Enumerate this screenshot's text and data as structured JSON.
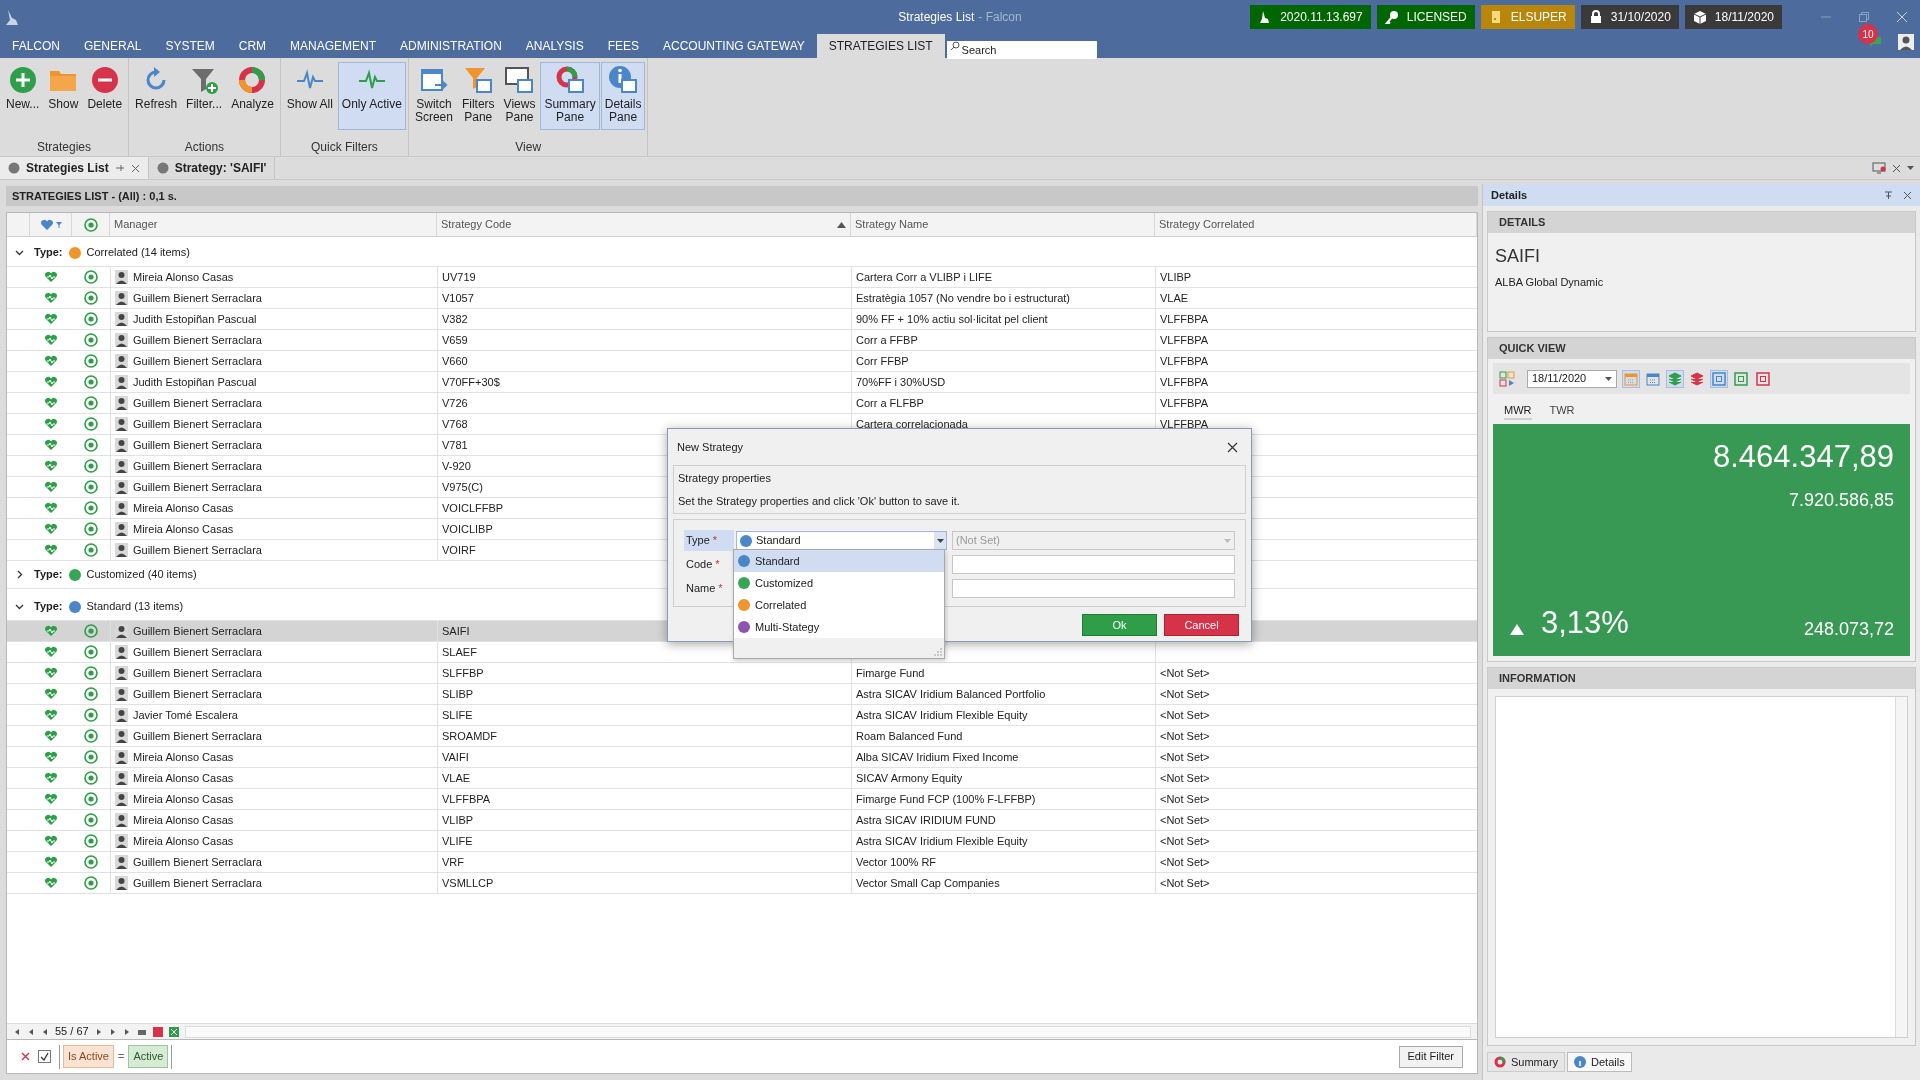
{
  "window": {
    "title": "Strategies List",
    "app_suffix": "- Falcon"
  },
  "status_badges": [
    {
      "label": "2020.11.13.697",
      "color": "#006600"
    },
    {
      "label": "LICENSED",
      "color": "#006600"
    },
    {
      "label": "ELSUPER",
      "color": "#b8860b"
    },
    {
      "label": "31/10/2020",
      "color": "#3a3a3a"
    },
    {
      "label": "18/11/2020",
      "color": "#3a3a3a"
    }
  ],
  "notification_count": "10",
  "menu": [
    {
      "label": "FALCON",
      "selected": false
    },
    {
      "label": "GENERAL",
      "selected": false
    },
    {
      "label": "SYSTEM",
      "selected": false
    },
    {
      "label": "CRM",
      "selected": false
    },
    {
      "label": "MANAGEMENT",
      "selected": false
    },
    {
      "label": "ADMINISTRATION",
      "selected": false
    },
    {
      "label": "ANALYSIS",
      "selected": false
    },
    {
      "label": "FEES",
      "selected": false
    },
    {
      "label": "ACCOUNTING GATEWAY",
      "selected": false
    },
    {
      "label": "STRATEGIES LIST",
      "selected": true
    }
  ],
  "search": {
    "placeholder": "Search"
  },
  "ribbon": [
    {
      "label": "Strategies",
      "buttons": [
        {
          "label": "New...",
          "selected": false
        },
        {
          "label": "Show",
          "selected": false
        },
        {
          "label": "Delete",
          "selected": false
        }
      ]
    },
    {
      "label": "Actions",
      "buttons": [
        {
          "label": "Refresh",
          "selected": false
        },
        {
          "label": "Filter...",
          "selected": false
        },
        {
          "label": "Analyze",
          "selected": false
        }
      ]
    },
    {
      "label": "Quick Filters",
      "buttons": [
        {
          "label": "Show All",
          "selected": false
        },
        {
          "label": "Only Active",
          "selected": true
        }
      ]
    },
    {
      "label": "View",
      "buttons": [
        {
          "label": "Switch\nScreen",
          "selected": false
        },
        {
          "label": "Filters\nPane",
          "selected": false
        },
        {
          "label": "Views\nPane",
          "selected": false
        },
        {
          "label": "Summary\nPane",
          "selected": true
        },
        {
          "label": "Details\nPane",
          "selected": true
        }
      ]
    }
  ],
  "document_tabs": [
    {
      "label": "Strategies List",
      "selected": true
    },
    {
      "label": "Strategy: 'SAIFI'",
      "selected": false
    }
  ],
  "grid": {
    "title": "STRATEGIES LIST - (All) : 0,1 s.",
    "columns": [
      "Manager",
      "Strategy Code",
      "Strategy Name",
      "Strategy Correlated"
    ],
    "groups": [
      {
        "prefix": "Type:",
        "label": "Correlated (14 items)",
        "color": "#f0952e",
        "expanded": true,
        "rows": [
          {
            "manager": "Mireia Alonso Casas",
            "code": "UV719",
            "name": "Cartera Corr a VLIBP i LIFE",
            "correlated": "VLIBP",
            "selected": false
          },
          {
            "manager": "Guillem Bienert Serraclara",
            "code": "V1057",
            "name": "Estratègia 1057 (No vendre bo i estructurat)",
            "correlated": "VLAE",
            "selected": false
          },
          {
            "manager": "Judith Estopiñan Pascual",
            "code": "V382",
            "name": "90% FF + 10% actiu sol·licitat pel client",
            "correlated": "VLFFBPA",
            "selected": false
          },
          {
            "manager": "Guillem Bienert Serraclara",
            "code": "V659",
            "name": "Corr a FFBP",
            "correlated": "VLFFBPA",
            "selected": false
          },
          {
            "manager": "Guillem Bienert Serraclara",
            "code": "V660",
            "name": "Corr FFBP",
            "correlated": "VLFFBPA",
            "selected": false
          },
          {
            "manager": "Judith Estopiñan Pascual",
            "code": "V70FF+30$",
            "name": "70%FF i 30%USD",
            "correlated": "VLFFBPA",
            "selected": false
          },
          {
            "manager": "Guillem Bienert Serraclara",
            "code": "V726",
            "name": "Corr a FLFBP",
            "correlated": "VLFFBPA",
            "selected": false
          },
          {
            "manager": "Guillem Bienert Serraclara",
            "code": "V768",
            "name": "Cartera correlacionada",
            "correlated": "VLFFBPA",
            "selected": false
          },
          {
            "manager": "Guillem Bienert Serraclara",
            "code": "V781",
            "selected": false
          },
          {
            "manager": "Guillem Bienert Serraclara",
            "code": "V-920",
            "selected": false
          },
          {
            "manager": "Guillem Bienert Serraclara",
            "code": "V975(C)",
            "selected": false
          },
          {
            "manager": "Mireia Alonso Casas",
            "code": "VOICLFFBP",
            "selected": false
          },
          {
            "manager": "Mireia Alonso Casas",
            "code": "VOICLIBP",
            "selected": false
          },
          {
            "manager": "Guillem Bienert Serraclara",
            "code": "VOIRF",
            "selected": false
          }
        ]
      },
      {
        "prefix": "Type:",
        "label": "Customized (40 items)",
        "color": "#3aa655",
        "expanded": false
      },
      {
        "prefix": "Type:",
        "label": "Standard (13 items)",
        "color": "#4a86c8",
        "expanded": true,
        "rows": [
          {
            "manager": "Guillem Bienert Serraclara",
            "code": "SAIFI",
            "selected": true
          },
          {
            "manager": "Guillem Bienert Serraclara",
            "code": "SLAEF",
            "selected": false
          },
          {
            "manager": "Guillem Bienert Serraclara",
            "code": "SLFFBP",
            "name": "Fimarge Fund",
            "correlated": "<Not Set>",
            "selected": false
          },
          {
            "manager": "Guillem Bienert Serraclara",
            "code": "SLIBP",
            "name": "Astra SICAV Iridium Balanced Portfolio",
            "correlated": "<Not Set>",
            "selected": false
          },
          {
            "manager": "Javier Tomé Escalera",
            "code": "SLIFE",
            "name": "Astra SICAV Iridium Flexible Equity",
            "correlated": "<Not Set>",
            "selected": false
          },
          {
            "manager": "Guillem Bienert Serraclara",
            "code": "SROAMDF",
            "name": "Roam Balanced Fund",
            "correlated": "<Not Set>",
            "selected": false
          },
          {
            "manager": "Mireia Alonso Casas",
            "code": "VAIFI",
            "name": "Alba SICAV Iridium Fixed Income",
            "correlated": "<Not Set>",
            "selected": false
          },
          {
            "manager": "Mireia Alonso Casas",
            "code": "VLAE",
            "name": "SICAV Armony Equity",
            "correlated": "<Not Set>",
            "selected": false
          },
          {
            "manager": "Mireia Alonso Casas",
            "code": "VLFFBPA",
            "name": "Fimarge Fund FCP (100% F-LFFBP)",
            "correlated": "<Not Set>",
            "selected": false
          },
          {
            "manager": "Mireia Alonso Casas",
            "code": "VLIBP",
            "name": "Astra SICAV IRIDIUM FUND",
            "correlated": "<Not Set>",
            "selected": false
          },
          {
            "manager": "Mireia Alonso Casas",
            "code": "VLIFE",
            "name": "Astra SICAV Iridium Flexible Equity",
            "correlated": "<Not Set>",
            "selected": false
          },
          {
            "manager": "Guillem Bienert Serraclara",
            "code": "VRF",
            "name": "Vector 100% RF",
            "correlated": "<Not Set>",
            "selected": false
          },
          {
            "manager": "Guillem Bienert Serraclara",
            "code": "VSMLLCP",
            "name": "Vector Small Cap Companies",
            "correlated": "<Not Set>",
            "selected": false
          }
        ]
      }
    ]
  },
  "pager": "55 / 67",
  "filter": {
    "enabled": true,
    "field": "Is Active",
    "operator": "=",
    "value": "Active"
  },
  "edit_filter": "Edit Filter",
  "dialog": {
    "title": "New Strategy",
    "section_title": "Strategy properties",
    "section_text": "Set the Strategy properties and click 'Ok' button to save it.",
    "fields": [
      {
        "label": "Type",
        "marker": "*",
        "focused": true
      },
      {
        "label": "Code",
        "marker": "*",
        "focused": false
      },
      {
        "label": "Name",
        "marker": "*",
        "focused": false
      }
    ],
    "type_value": "Standard",
    "secondary_placeholder": "(Not Set)",
    "options": [
      {
        "label": "Standard",
        "color": "#4a86c8",
        "selected": true
      },
      {
        "label": "Customized",
        "color": "#3aa655",
        "selected": false
      },
      {
        "label": "Correlated",
        "color": "#f0952e",
        "selected": false
      },
      {
        "label": "Multi-Stategy",
        "color": "#8e55b0",
        "selected": false
      }
    ],
    "ok": "Ok",
    "cancel": "Cancel"
  },
  "details_pane": {
    "title": "Details",
    "details_header": "DETAILS",
    "code": "SAIFI",
    "name": "ALBA Global Dynamic",
    "quick_view_header": "QUICK VIEW",
    "date": "18/11/2020",
    "tabs": [
      {
        "label": "MWR",
        "selected": true
      },
      {
        "label": "TWR",
        "selected": false
      }
    ],
    "value": "8.464.347,89",
    "base_value": "7.920.586,85",
    "rising": true,
    "return": "3,13%",
    "gain": "248.073,72",
    "information_header": "INFORMATION",
    "bottom_tabs": [
      {
        "label": "Summary",
        "selected": false
      },
      {
        "label": "Details",
        "selected": true
      }
    ]
  }
}
